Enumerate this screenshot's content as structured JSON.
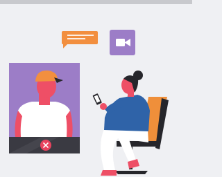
{
  "illustration": {
    "colors": {
      "background": "#eff0f3",
      "top_bar": "#c8c9cd",
      "chat_bubble": "#f28f3f",
      "video_badge": "#9c7dc7",
      "call_window": "#9c7dc7",
      "call_controls_bar": "#3a3a42",
      "end_call_button": "#e8435e",
      "skin": "#ee4f66",
      "cap": "#f28f3f",
      "hair": "#26262b",
      "shirt_white": "#ffffff",
      "jacket_blue": "#2f63a8",
      "chair_orange": "#ef8f3a",
      "pants_white": "#ffffff"
    },
    "icons": {
      "chat": "chat-bubble-icon",
      "video": "video-camera-icon",
      "end_call": "close-icon"
    }
  }
}
